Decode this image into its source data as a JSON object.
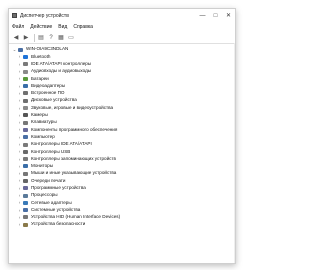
{
  "window": {
    "title": "Диспетчер устройств",
    "controls": {
      "minimize": "—",
      "maximize": "□",
      "close": "✕"
    }
  },
  "menu": [
    "Файл",
    "Действие",
    "Вид",
    "Справка"
  ],
  "toolbar": [
    "back-icon",
    "forward-icon",
    "properties-icon",
    "help-icon",
    "scan-hardware-icon",
    "monitor-icon"
  ],
  "tree": {
    "root": {
      "label": "WIN-OIA9C3NDLAN",
      "icon": "computer-icon",
      "color": "#4a6fa5"
    },
    "items": [
      {
        "label": "Bluetooth",
        "icon": "bluetooth-icon",
        "color": "#1e73d8"
      },
      {
        "label": "IDE ATA/ATAPI контроллеры",
        "icon": "ide-controller-icon",
        "color": "#7a7a7a"
      },
      {
        "label": "Аудиовходы и аудиовыходы",
        "icon": "speaker-icon",
        "color": "#8a8a8a"
      },
      {
        "label": "Батареи",
        "icon": "battery-icon",
        "color": "#5a9a3a"
      },
      {
        "label": "Видеоадаптеры",
        "icon": "display-adapter-icon",
        "color": "#3a6ea8"
      },
      {
        "label": "Встроенное ПО",
        "icon": "firmware-icon",
        "color": "#707070"
      },
      {
        "label": "Дисковые устройства",
        "icon": "disk-drive-icon",
        "color": "#6f6f6f"
      },
      {
        "label": "Звуковые, игровые и видеоустройства",
        "icon": "sound-icon",
        "color": "#8a8a8a"
      },
      {
        "label": "Камеры",
        "icon": "camera-icon",
        "color": "#555555"
      },
      {
        "label": "Клавиатуры",
        "icon": "keyboard-icon",
        "color": "#777777"
      },
      {
        "label": "Компоненты программного обеспечения",
        "icon": "software-component-icon",
        "color": "#6a6a9a"
      },
      {
        "label": "Компьютер",
        "icon": "computer-icon",
        "color": "#4a6fa5"
      },
      {
        "label": "Контроллеры IDE ATA/ATAPI",
        "icon": "ide-controller-icon",
        "color": "#7a7a7a"
      },
      {
        "label": "Контроллеры USB",
        "icon": "usb-icon",
        "color": "#6a6a6a"
      },
      {
        "label": "Контроллеры запоминающих устройств",
        "icon": "storage-controller-icon",
        "color": "#7a7a7a"
      },
      {
        "label": "Мониторы",
        "icon": "monitor-icon",
        "color": "#3a6ea8"
      },
      {
        "label": "Мыши и иные указывающие устройства",
        "icon": "mouse-icon",
        "color": "#777777"
      },
      {
        "label": "Очереди печати",
        "icon": "printer-icon",
        "color": "#666666"
      },
      {
        "label": "Программные устройства",
        "icon": "software-device-icon",
        "color": "#6a6a9a"
      },
      {
        "label": "Процессоры",
        "icon": "processor-icon",
        "color": "#5a7a9a"
      },
      {
        "label": "Сетевые адаптеры",
        "icon": "network-adapter-icon",
        "color": "#3a7ab8"
      },
      {
        "label": "Системные устройства",
        "icon": "system-device-icon",
        "color": "#4a6fa5"
      },
      {
        "label": "Устройства HID (Human Interface Devices)",
        "icon": "hid-icon",
        "color": "#777777"
      },
      {
        "label": "Устройства безопасности",
        "icon": "security-device-icon",
        "color": "#8a7a4a"
      }
    ]
  }
}
